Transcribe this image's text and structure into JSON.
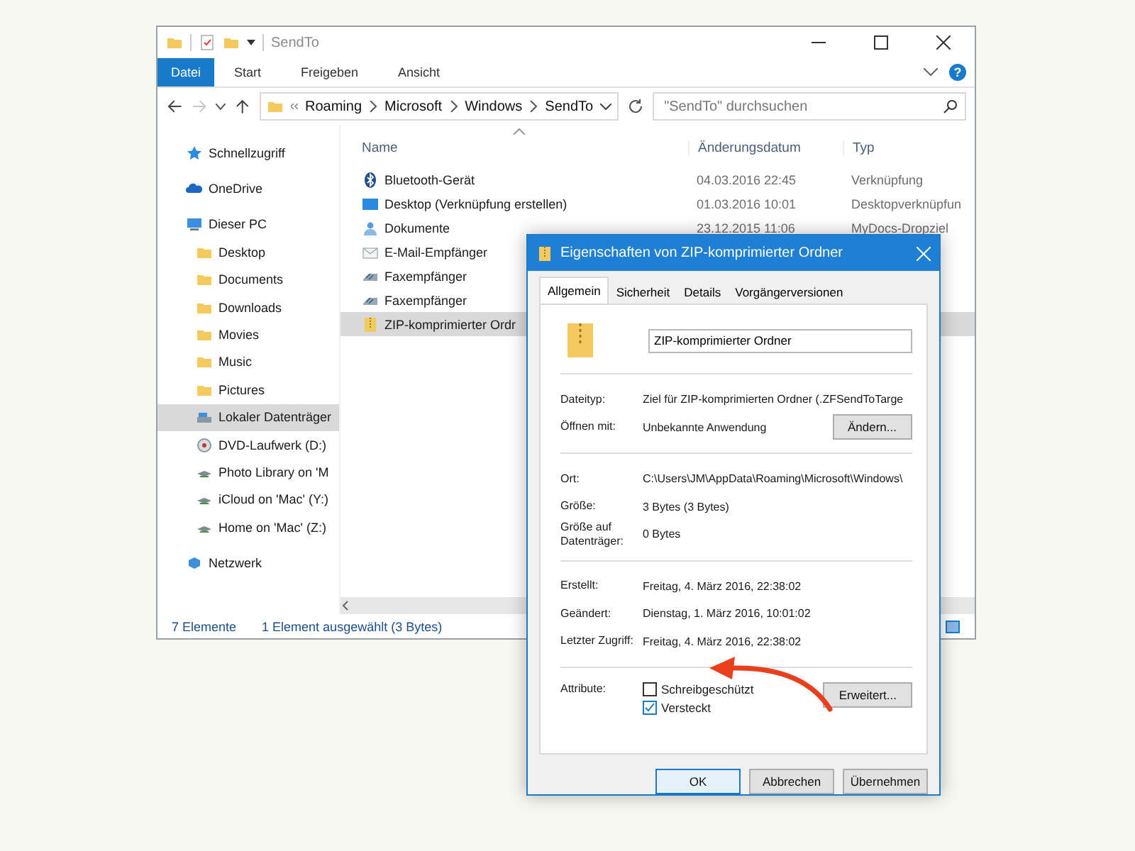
{
  "explorer": {
    "title": "SendTo",
    "ribbon_tabs": [
      {
        "label": "Datei",
        "kind": "file"
      },
      {
        "label": "Start",
        "kind": "tab"
      },
      {
        "label": "Freigeben",
        "kind": "tab"
      },
      {
        "label": "Ansicht",
        "kind": "tab"
      }
    ],
    "help": "?",
    "breadcrumb": [
      "Roaming",
      "Microsoft",
      "Windows",
      "SendTo"
    ],
    "search": {
      "placeholder": "\"SendTo\" durchsuchen"
    },
    "sidebar": {
      "items": [
        {
          "kind": "quick-access",
          "label": "Schnellzugriff",
          "selected": false
        },
        {
          "kind": "cloud",
          "label": "OneDrive",
          "selected": false
        },
        {
          "kind": "computer",
          "label": "Dieser PC",
          "selected": false,
          "children": [
            {
              "kind": "folder",
              "label": "Desktop",
              "selected": false
            },
            {
              "kind": "folder",
              "label": "Documents",
              "selected": false
            },
            {
              "kind": "folder",
              "label": "Downloads",
              "selected": false
            },
            {
              "kind": "folder",
              "label": "Movies",
              "selected": false
            },
            {
              "kind": "folder",
              "label": "Music",
              "selected": false
            },
            {
              "kind": "folder",
              "label": "Pictures",
              "selected": false
            },
            {
              "kind": "drive",
              "label": "Lokaler Datenträger",
              "selected": true
            },
            {
              "kind": "optical-drive",
              "label": "DVD-Laufwerk (D:)",
              "selected": false
            },
            {
              "kind": "network-drive",
              "label": "Photo Library on 'M",
              "selected": false
            },
            {
              "kind": "network-drive",
              "label": "iCloud on 'Mac' (Y:)",
              "selected": false
            },
            {
              "kind": "network-drive",
              "label": "Home on 'Mac' (Z:)",
              "selected": false
            }
          ]
        },
        {
          "kind": "network",
          "label": "Netzwerk",
          "selected": false
        }
      ]
    },
    "columns": [
      "Name",
      "Änderungsdatum",
      "Typ"
    ],
    "rows": [
      {
        "kind": "bluetooth",
        "name": "Bluetooth-Gerät",
        "date": "04.03.2016 22:45",
        "type": "Verknüpfung",
        "selected": false
      },
      {
        "kind": "desktop",
        "name": "Desktop (Verknüpfung erstellen)",
        "date": "01.03.2016 10:01",
        "type": "Desktopverknüpfun",
        "selected": false
      },
      {
        "kind": "documents",
        "name": "Dokumente",
        "date": "23.12.2015 11:06",
        "type": "MyDocs-Dropziel",
        "selected": false
      },
      {
        "kind": "mail",
        "name": "E-Mail-Empfänger",
        "selected": false
      },
      {
        "kind": "fax",
        "name": "Faxempfänger",
        "selected": false
      },
      {
        "kind": "fax",
        "name": "Faxempfänger",
        "selected": false
      },
      {
        "kind": "zip",
        "name": "ZIP-komprimierter Ordr",
        "selected": true
      }
    ],
    "status_bar": {
      "count": "7 Elemente",
      "selection": "1 Element ausgewählt (3 Bytes)"
    }
  },
  "dialog": {
    "title": "Eigenschaften von ZIP-komprimierter Ordner",
    "tabs": [
      {
        "label": "Allgemein",
        "selected": true
      },
      {
        "label": "Sicherheit",
        "selected": false
      },
      {
        "label": "Details",
        "selected": false
      },
      {
        "label": "Vorgängerversionen",
        "selected": false
      }
    ],
    "name_value": "ZIP-komprimierter Ordner",
    "sections": [
      {
        "rows": [
          {
            "label": "Dateityp:",
            "value": "Ziel für ZIP-komprimierten Ordner (.ZFSendToTarge"
          },
          {
            "label": "Öffnen mit:",
            "value": "Unbekannte Anwendung",
            "button": "Ändern..."
          }
        ]
      },
      {
        "rows": [
          {
            "label": "Ort:",
            "value": "C:\\Users\\JM\\AppData\\Roaming\\Microsoft\\Windows\\"
          },
          {
            "label": "Größe:",
            "value": "3 Bytes (3 Bytes)"
          },
          {
            "label": "Größe auf Datenträger:",
            "value": "0 Bytes"
          }
        ]
      },
      {
        "rows": [
          {
            "label": "Erstellt:",
            "value": "Freitag, 4. März 2016, 22:38:02"
          },
          {
            "label": "Geändert:",
            "value": "Dienstag, 1. März 2016, 10:01:02"
          },
          {
            "label": "Letzter Zugriff:",
            "value": "Freitag, 4. März 2016, 22:38:02"
          }
        ]
      }
    ],
    "attributes": {
      "label": "Attribute:",
      "button": "Erweitert...",
      "options": [
        {
          "label": "Schreibgeschützt",
          "checked": false
        },
        {
          "label": "Versteckt",
          "checked": true
        }
      ]
    },
    "buttons": [
      {
        "label": "OK",
        "kind": "default"
      },
      {
        "label": "Abbrechen",
        "kind": "normal"
      },
      {
        "label": "Übernehmen",
        "kind": "normal"
      }
    ]
  }
}
